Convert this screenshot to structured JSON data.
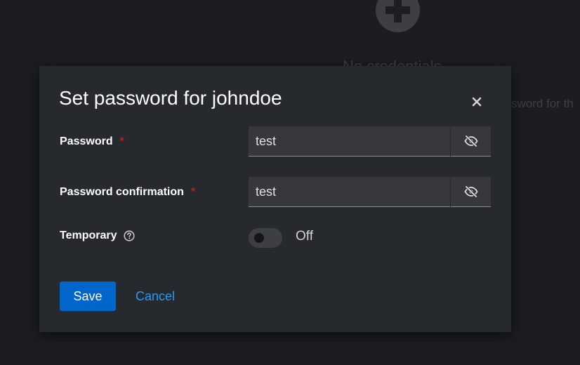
{
  "background": {
    "empty_state_title": "No credentials",
    "empty_state_body": "sword for th"
  },
  "modal": {
    "title": "Set password for johndoe",
    "close_icon": "close-icon"
  },
  "fields": {
    "password": {
      "label": "Password",
      "required_marker": "*",
      "value": "test",
      "visibility_icon": "eye-slash-icon"
    },
    "password_confirmation": {
      "label": "Password confirmation",
      "required_marker": "*",
      "value": "test",
      "visibility_icon": "eye-slash-icon"
    },
    "temporary": {
      "label": "Temporary",
      "help_icon": "question-circle-icon",
      "state_label": "Off",
      "checked": false
    }
  },
  "actions": {
    "save_label": "Save",
    "cancel_label": "Cancel"
  },
  "colors": {
    "primary": "#0066cc",
    "link": "#2b9af3",
    "required": "#c9190b",
    "modal_bg": "#26292d",
    "backdrop": "#1b1d21"
  }
}
